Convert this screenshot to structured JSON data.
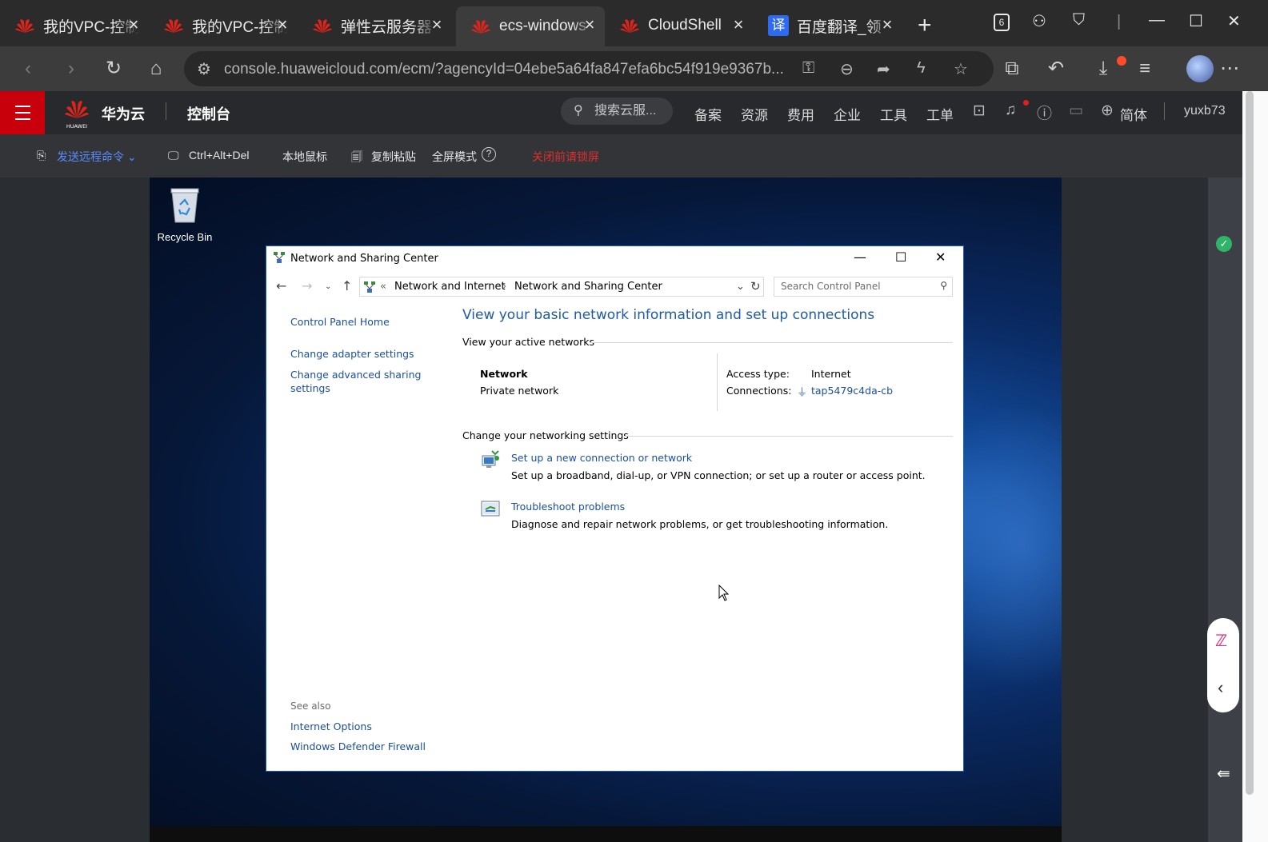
{
  "browser": {
    "tabs": [
      {
        "title": "我的VPC-控制台",
        "active": false
      },
      {
        "title": "我的VPC-控制台",
        "active": false
      },
      {
        "title": "弹性云服务器",
        "active": false
      },
      {
        "title": "ecs-windows",
        "active": true
      },
      {
        "title": "CloudShell",
        "active": false
      },
      {
        "title": "百度翻译_领",
        "active": false
      }
    ],
    "tab_counter": "6",
    "url": "console.huaweicloud.com/ecm/?agencyId=04ebe5a64fa847efa6bc54f919e9367b..."
  },
  "huawei": {
    "brand": "华为云",
    "logo_text": "HUAWEI",
    "console": "控制台",
    "search_placeholder": "搜索云服...",
    "nav": [
      "备案",
      "资源",
      "费用",
      "企业",
      "工具",
      "工单"
    ],
    "language": "简体",
    "user": "yuxb73"
  },
  "remote_toolbar": {
    "send_cmd": "发送远程命令",
    "ctrl_alt_del": "Ctrl+Alt+Del",
    "local_mouse": "本地鼠标",
    "copy_paste": "复制粘贴",
    "fullscreen": "全屏模式",
    "lock_prompt": "关闭前请锁屏"
  },
  "desktop": {
    "recycle_bin": "Recycle Bin"
  },
  "window": {
    "title": "Network and Sharing Center",
    "breadcrumb": [
      "Network and Internet",
      "Network and Sharing Center"
    ],
    "breadcrumb_prefix": "«",
    "search_placeholder": "Search Control Panel",
    "left": {
      "home": "Control Panel Home",
      "adapter": "Change adapter settings",
      "advanced_line1": "Change advanced sharing",
      "advanced_line2": "settings",
      "see_also": "See also",
      "internet_options": "Internet Options",
      "firewall": "Windows Defender Firewall"
    },
    "heading": "View your basic network information and set up connections",
    "active_networks_label": "View your active networks",
    "network": {
      "name": "Network",
      "type": "Private network",
      "access_type_label": "Access type:",
      "access_type_value": "Internet",
      "connections_label": "Connections:",
      "connections_value": "tap5479c4da-cb"
    },
    "change_settings_label": "Change your networking settings",
    "tasks": [
      {
        "link": "Set up a new connection or network",
        "desc": "Set up a broadband, dial-up, or VPN connection; or set up a router or access point."
      },
      {
        "link": "Troubleshoot problems",
        "desc": "Diagnose and repair network problems, or get troubleshooting information."
      }
    ]
  },
  "colors": {
    "huawei_red": "#c7000b",
    "link_blue": "#1a4fa0",
    "heading_blue": "#1e5aa8",
    "status_green": "#2fb567"
  }
}
